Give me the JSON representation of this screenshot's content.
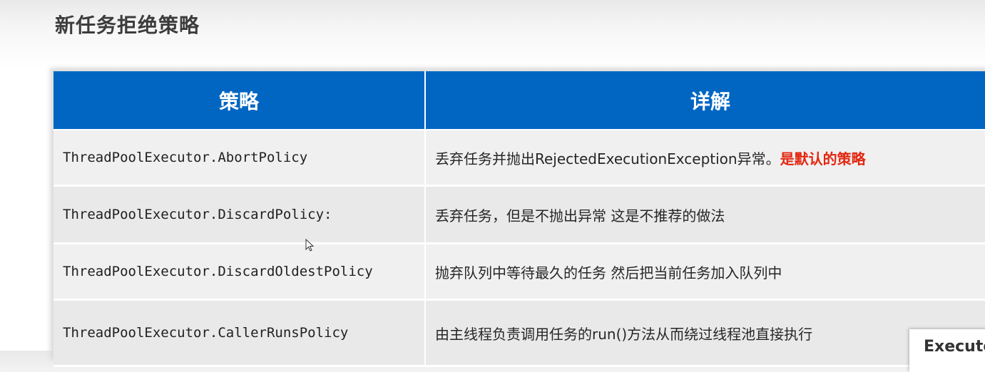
{
  "slide": {
    "title": "新任务拒绝策略"
  },
  "table": {
    "headers": {
      "policy": "策略",
      "detail": "详解"
    },
    "rows": [
      {
        "policy": "ThreadPoolExecutor.AbortPolicy",
        "detail": "丢弃任务并抛出RejectedExecutionException异常。",
        "highlight": "是默认的策略"
      },
      {
        "policy": "ThreadPoolExecutor.DiscardPolicy:",
        "detail": "丢弃任务，但是不抛出异常 这是不推荐的做法"
      },
      {
        "policy": "ThreadPoolExecutor.DiscardOldestPolicy",
        "detail": "抛弃队列中等待最久的任务 然后把当前任务加入队列中"
      },
      {
        "policy": "ThreadPoolExecutor.CallerRunsPolicy",
        "detail": "由主线程负责调用任务的run()方法从而绕过线程池直接执行"
      }
    ]
  },
  "corner_card": {
    "label": "Executo"
  },
  "colors": {
    "header_bg": "#0066c2",
    "highlight": "#e3260f"
  },
  "cursor_icon": "pointer-cursor-icon"
}
